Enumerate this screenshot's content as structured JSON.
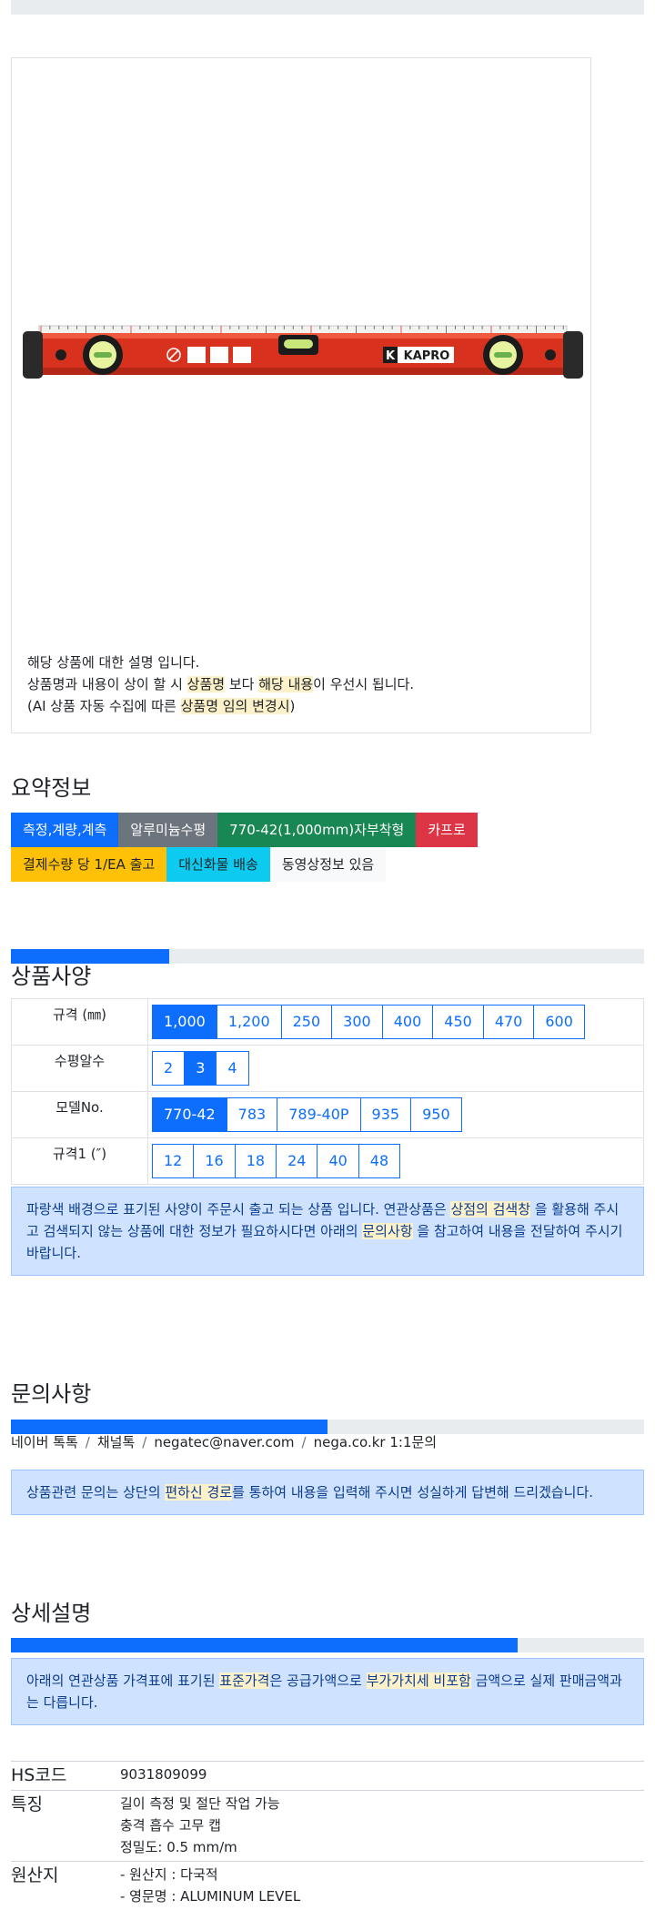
{
  "product": {
    "image_alt": "KAPRO level",
    "brand_on_image": "KAPRO",
    "description_lines": [
      {
        "parts": [
          {
            "text": "해당 상품에 대한 설명 입니다.",
            "hl": false
          }
        ]
      },
      {
        "parts": [
          {
            "text": "상품명과 내용이 상이 할 시 ",
            "hl": false
          },
          {
            "text": "상품명",
            "hl": true
          },
          {
            "text": " 보다 ",
            "hl": false
          },
          {
            "text": "해당 내용",
            "hl": true
          },
          {
            "text": "이 우선시 됩니다.",
            "hl": false
          }
        ]
      },
      {
        "parts": [
          {
            "text": "(AI 상품 자동 수집에 따른 ",
            "hl": false
          },
          {
            "text": "상품명 임의 변경시",
            "hl": true
          },
          {
            "text": ")",
            "hl": false
          }
        ]
      }
    ]
  },
  "summary": {
    "title": "요약정보",
    "row1": [
      {
        "label": "측정,계량,계측",
        "color": "#0d6efd"
      },
      {
        "label": "알루미늄수평",
        "color": "#6c757d"
      },
      {
        "label": "770-42(1,000mm)자부착형",
        "color": "#198754"
      },
      {
        "label": "카프로",
        "color": "#dc3545"
      }
    ],
    "row2": [
      {
        "label": "결제수량 당 1/EA 출고",
        "color": "#ffc107",
        "text_color": "#212529"
      },
      {
        "label": "대신화물 배송",
        "color": "#0dcaf0",
        "text_color": "#212529"
      },
      {
        "label": "동영상정보 있음",
        "color": "#f8f9fa",
        "text_color": "#212529"
      }
    ]
  },
  "spec": {
    "title": "상품사양",
    "progress_percent": 25,
    "rows": [
      {
        "label": "규격 (㎜)",
        "options": [
          "1,000",
          "1,200",
          "250",
          "300",
          "400",
          "450",
          "470",
          "600"
        ],
        "selected": 0
      },
      {
        "label": "수평알수",
        "options": [
          "2",
          "3",
          "4"
        ],
        "selected": 1
      },
      {
        "label": "모델No.",
        "options": [
          "770-42",
          "783",
          "789-40P",
          "935",
          "950"
        ],
        "selected": 0
      },
      {
        "label": "규격1 (″)",
        "options": [
          "12",
          "16",
          "18",
          "24",
          "40",
          "48"
        ],
        "selected": -1
      }
    ],
    "notice": [
      {
        "text": "파랑색 배경으로 표기된 사양이 주문시 출고 되는 상품 입니다. 연관상품은 ",
        "hl": false
      },
      {
        "text": "상점의 검색창",
        "hl": true
      },
      {
        "text": " 을 활용해 주시고 검색되지 않는 상품에 대한 정보가 필요하시다면 아래의 ",
        "hl": false
      },
      {
        "text": "문의사항",
        "hl": true
      },
      {
        "text": " 을 참고하여 내용을 전달하여 주시기 바랍니다.",
        "hl": false
      }
    ]
  },
  "inquiry": {
    "title": "문의사항",
    "progress_percent": 50,
    "contacts": [
      "네이버 톡톡",
      "채널톡",
      "negatec@naver.com",
      "nega.co.kr 1:1문의"
    ],
    "notice": [
      {
        "text": "상품관련 문의는 상단의 ",
        "hl": false
      },
      {
        "text": "편하신 경로",
        "hl": true
      },
      {
        "text": "를 통하여 내용을 입력해 주시면 성실하게 답변해 드리겠습니다.",
        "hl": false
      }
    ]
  },
  "detail": {
    "title": "상세설명",
    "progress_percent": 80,
    "notice": [
      {
        "text": "아래의 연관상품 가격표에 표기된 ",
        "hl": false
      },
      {
        "text": "표준가격",
        "hl": true
      },
      {
        "text": "은 공급가액으로 ",
        "hl": false
      },
      {
        "text": "부가가치세 비포함",
        "hl": true
      },
      {
        "text": " 금액으로 실제 판매금액과는 다릅니다.",
        "hl": false
      }
    ],
    "info": [
      {
        "key": "HS코드",
        "lines": [
          "9031809099"
        ]
      },
      {
        "key": "특징",
        "lines": [
          "길이 측정 및 절단 작업 가능",
          "충격 흡수 고무 캡",
          "정밀도: 0.5 mm/m"
        ]
      },
      {
        "key": "원산지",
        "lines": [
          "- 원산지 : 다국적",
          "- 영문명 : ALUMINUM LEVEL"
        ]
      }
    ]
  }
}
